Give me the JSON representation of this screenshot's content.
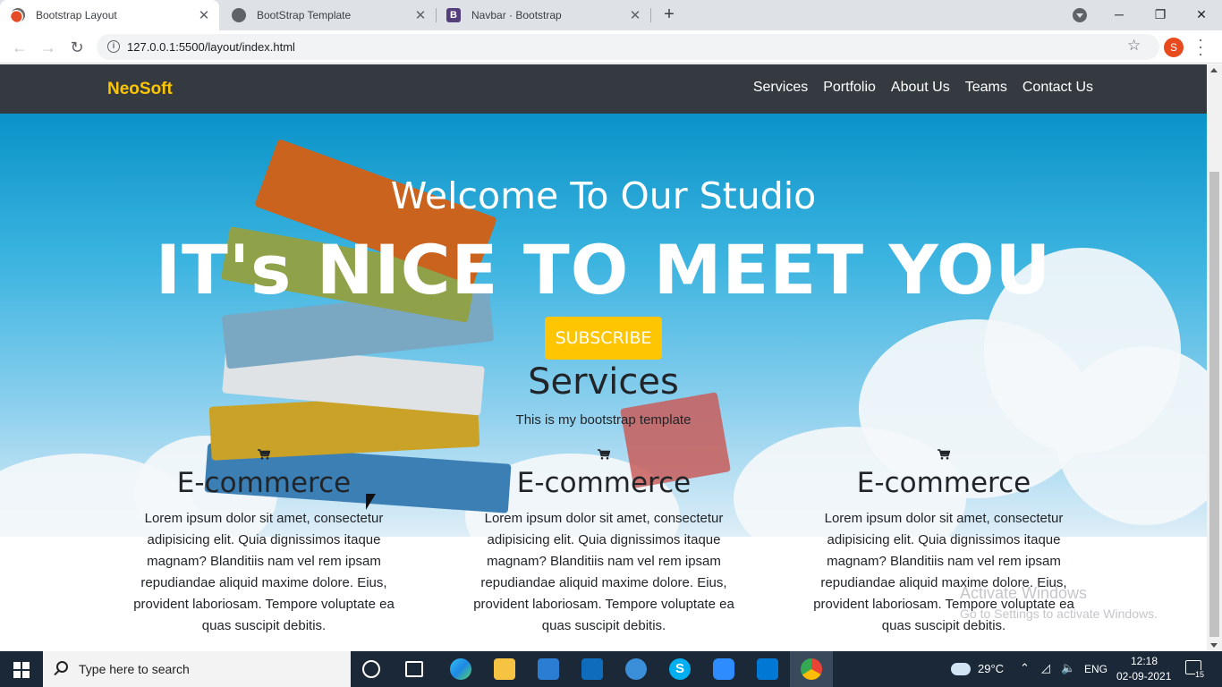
{
  "browser": {
    "tabs": [
      {
        "title": "Bootstrap Layout",
        "active": true
      },
      {
        "title": "BootStrap Template",
        "active": false
      },
      {
        "title": "Navbar · Bootstrap",
        "active": false
      }
    ],
    "new_tab": "+",
    "url": "127.0.0.1:5500/layout/index.html",
    "profile_initial": "S"
  },
  "site": {
    "brand": "NeoSoft",
    "nav": [
      "Services",
      "Portfolio",
      "About Us",
      "Teams",
      "Contact Us"
    ],
    "hero_welcome": "Welcome To Our Studio",
    "hero_big": "IT's NICE TO MEET YOU",
    "subscribe": "SUBSCRIBE",
    "services_title": "Services",
    "services_sub": "This is my bootstrap template",
    "cards": [
      {
        "title": "E-commerce",
        "text": "Lorem ipsum dolor sit amet, consectetur adipisicing elit. Quia dignissimos itaque magnam? Blanditiis nam vel rem ipsam repudiandae aliquid maxime dolore. Eius, provident laboriosam. Tempore voluptate ea quas suscipit debitis."
      },
      {
        "title": "E-commerce",
        "text": "Lorem ipsum dolor sit amet, consectetur adipisicing elit. Quia dignissimos itaque magnam? Blanditiis nam vel rem ipsam repudiandae aliquid maxime dolore. Eius, provident laboriosam. Tempore voluptate ea quas suscipit debitis."
      },
      {
        "title": "E-commerce",
        "text": "Lorem ipsum dolor sit amet, consectetur adipisicing elit. Quia dignissimos itaque magnam? Blanditiis nam vel rem ipsam repudiandae aliquid maxime dolore. Eius, provident laboriosam. Tempore voluptate ea quas suscipit debitis."
      }
    ],
    "watermark_title": "Activate Windows",
    "watermark_sub": "Go to Settings to activate Windows."
  },
  "taskbar": {
    "search_placeholder": "Type here to search",
    "weather": "29°C",
    "language": "ENG",
    "time": "12:18",
    "date": "02-09-2021",
    "notification_count": "15"
  },
  "colors": {
    "brand": "#fec503",
    "navbar": "#343a40",
    "taskbar": "#1b2838"
  }
}
